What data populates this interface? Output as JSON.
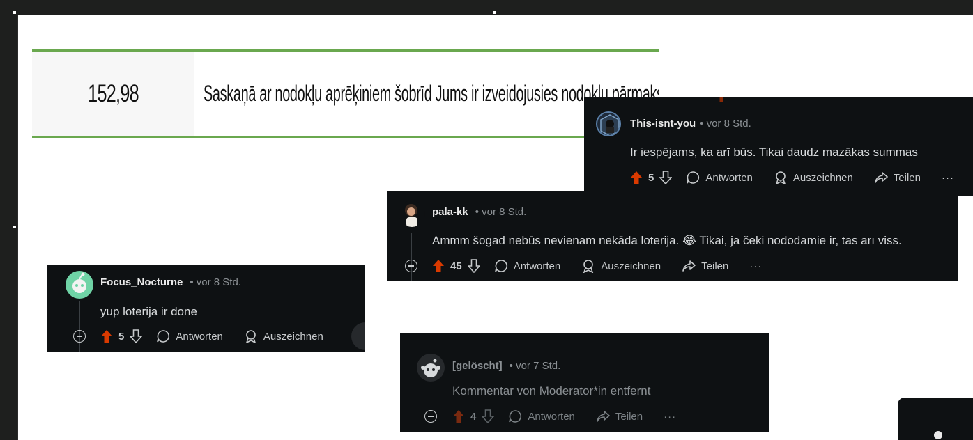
{
  "tax": {
    "amount": "152,98",
    "text": "Saskaņā ar nodokļu aprēķiniem šobrīd Jums ir izveidojusies nodokļu pārmaksa"
  },
  "labels": {
    "reply": "Antworten",
    "award": "Auszeichnen",
    "share": "Teilen",
    "more": "···"
  },
  "comments": {
    "this_isnt_you": {
      "user": "This-isnt-you",
      "time": "• vor 8 Std.",
      "body": "Ir iespējams, ka arī būs. Tikai daudz mazākas summas",
      "votes": "5"
    },
    "pala_kk": {
      "user": "pala-kk",
      "time": "• vor 8 Std.",
      "body": "Ammm šogad nebūs nevienam nekāda loterija. 😂 Tikai, ja čeki nododamie ir, tas arī viss.",
      "votes": "45"
    },
    "focus_nocturne": {
      "user": "Focus_Nocturne",
      "time": "• vor 8 Std.",
      "body": "yup loterija ir done",
      "votes": "5"
    },
    "deleted": {
      "user": "[gelöscht]",
      "time": "• vor 7 Std.",
      "body": "Kommentar von Moderator*in entfernt",
      "votes": "4"
    }
  },
  "colors": {
    "upvote": "#d93a00",
    "upvote_dim": "#7a2a10",
    "card_bg": "#0e1113",
    "table_border": "#6aa84f"
  }
}
